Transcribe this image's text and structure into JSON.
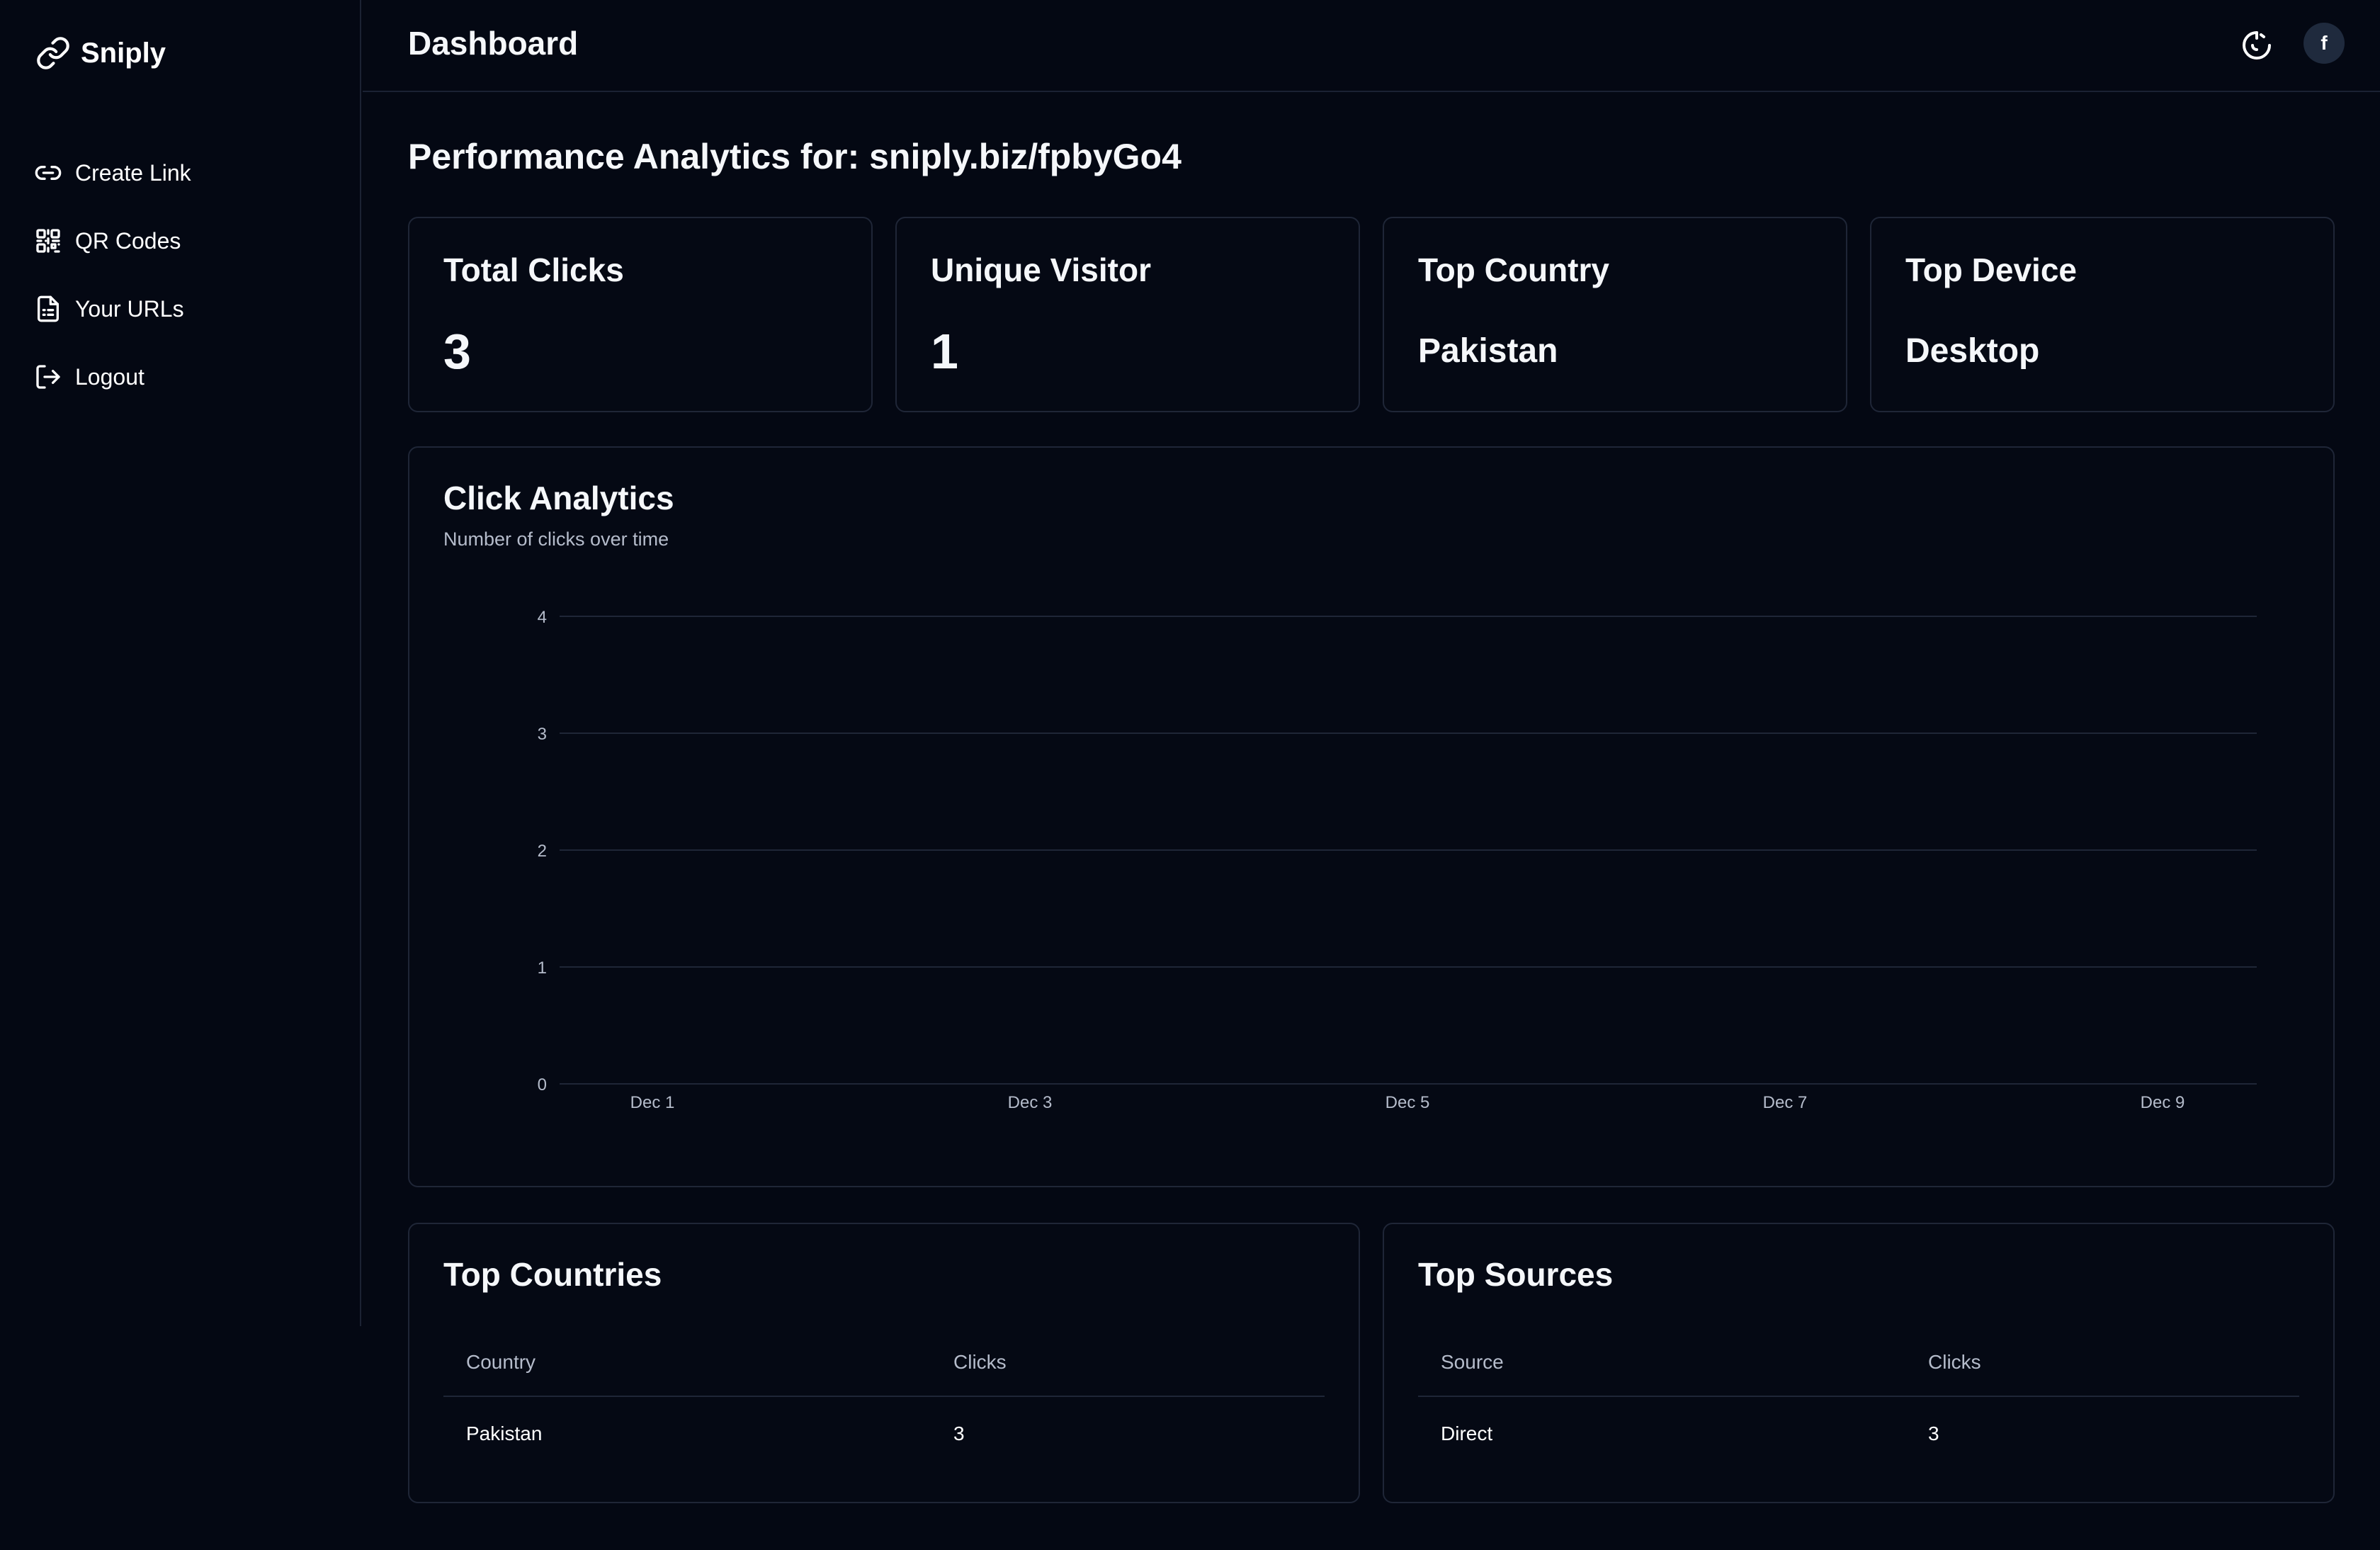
{
  "app": {
    "name": "Sniply"
  },
  "sidebar": {
    "items": [
      {
        "label": "Create Link",
        "icon": "link-icon"
      },
      {
        "label": "QR Codes",
        "icon": "qr-code-icon"
      },
      {
        "label": "Your URLs",
        "icon": "document-icon"
      },
      {
        "label": "Logout",
        "icon": "logout-icon"
      }
    ]
  },
  "header": {
    "title": "Dashboard",
    "theme_icon": "theme-toggle-icon",
    "avatar_initial": "f"
  },
  "main": {
    "title": "Performance Analytics for: sniply.biz/fpbyGo4",
    "stats": [
      {
        "label": "Total Clicks",
        "value": "3"
      },
      {
        "label": "Unique Visitor",
        "value": "1"
      },
      {
        "label": "Top Country",
        "value": "Pakistan"
      },
      {
        "label": "Top Device",
        "value": "Desktop"
      }
    ],
    "chart": {
      "title": "Click Analytics",
      "subtitle": "Number of clicks over time"
    },
    "top_countries": {
      "title": "Top Countries",
      "headers": [
        "Country",
        "Clicks"
      ],
      "rows": [
        [
          "Pakistan",
          "3"
        ]
      ]
    },
    "top_sources": {
      "title": "Top Sources",
      "headers": [
        "Source",
        "Clicks"
      ],
      "rows": [
        [
          "Direct",
          "3"
        ]
      ]
    }
  },
  "chart_data": {
    "type": "line",
    "x": [
      "Dec 1",
      "Dec 3",
      "Dec 5",
      "Dec 7",
      "Dec 9"
    ],
    "series": [],
    "ylim": [
      0,
      4
    ],
    "yticks": [
      "0",
      "1",
      "2",
      "3",
      "4"
    ],
    "grid": true,
    "gridColor": "#1f2637",
    "tickColor": "#b5bccb"
  }
}
